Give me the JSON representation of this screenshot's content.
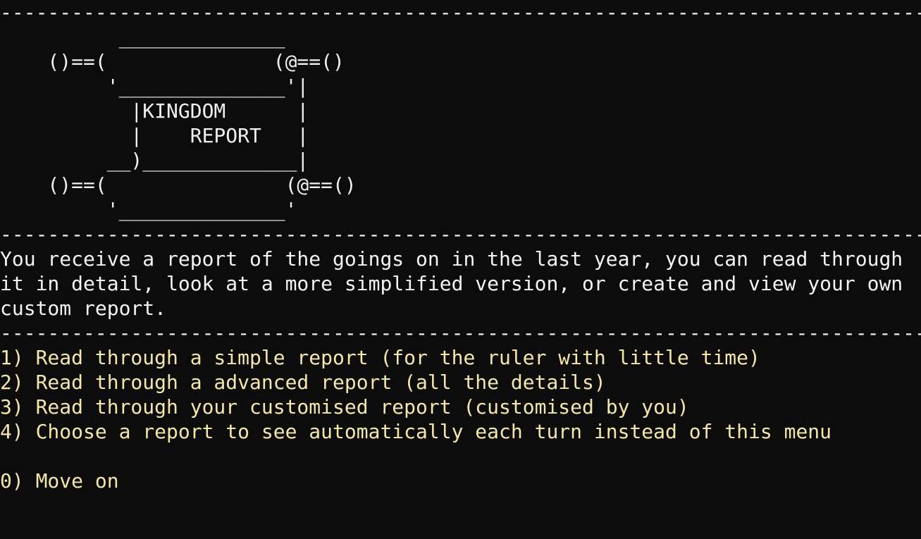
{
  "terminal": {
    "separator": "------------------------------------------------------------------------------------------",
    "banner": [
      "",
      "          ______________",
      "    ()==(              (@==()",
      "         '______________'|",
      "           |KINGDOM      |",
      "           |    REPORT   |",
      "         __)_____________|",
      "    ()==(               (@==()",
      "         '______________'"
    ],
    "description": [
      "You receive a report of the goings on in the last year, you can read through",
      "it in detail, look at a more simplified version, or create and view your own",
      "custom report."
    ],
    "menu": [
      {
        "key": "1",
        "label": "1) Read through a simple report (for the ruler with little time)"
      },
      {
        "key": "2",
        "label": "2) Read through a advanced report (all the details)"
      },
      {
        "key": "3",
        "label": "3) Read through your customised report (customised by you)"
      },
      {
        "key": "4",
        "label": "4) Choose a report to see automatically each turn instead of this menu"
      },
      {
        "key": "0",
        "label": "0) Move on"
      }
    ]
  },
  "colors": {
    "background": "#0c0c0c",
    "text": "#f0f0f0",
    "menu_text": "#f5e7a8"
  }
}
